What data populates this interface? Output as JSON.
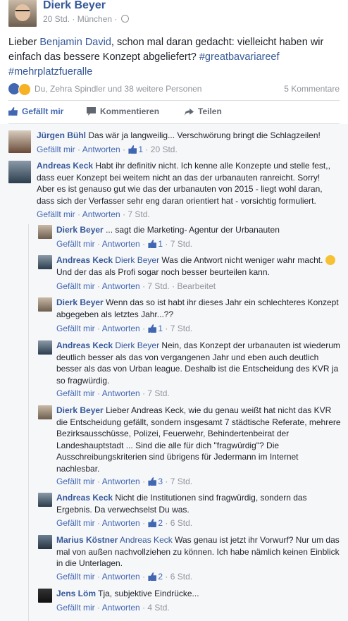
{
  "post": {
    "author": "Dierk Beyer",
    "time": "20 Std.",
    "location": "München",
    "text_before": "Lieber ",
    "mention": "Benjamin David",
    "text_after": ", schon mal daran gedacht: vielleicht haben wir einfach das bessere Konzept abgeliefert? ",
    "hashtag1": "#greatbavariareef",
    "hashtag2": "#mehrplatzfueralle"
  },
  "reactions": {
    "names": "Du, Zehra Spindler und 38 weitere Personen",
    "comment_count": "5 Kommentare"
  },
  "actions": {
    "like": "Gefällt mir",
    "comment": "Kommentieren",
    "share": "Teilen"
  },
  "labels": {
    "like": "Gefällt mir",
    "reply": "Antworten",
    "edited": "Bearbeitet"
  },
  "comments": [
    {
      "name": "Jürgen Bühl",
      "mention": "",
      "text": "Das wär ja langweilig... Verschwörung bringt die Schlagzeilen!",
      "likes": "1",
      "time": "20 Std."
    },
    {
      "name": "Andreas Keck",
      "mention": "",
      "text": "Habt ihr definitiv nicht. Ich kenne alle Konzepte und stelle fest,, dass euer Konzept bei weitem nicht an das der urbanauten ranreicht. Sorry! Aber es ist genauso gut wie das der urbanauten von 2015 - liegt wohl daran, dass sich der Verfasser sehr eng daran orientiert hat - vorsichtig formuliert.",
      "likes": "",
      "time": "7 Std."
    }
  ],
  "replies": [
    {
      "name": "Dierk Beyer",
      "mention": "",
      "text": "... sagt die Marketing- Agentur der Urbanauten",
      "likes": "1",
      "time": "7 Std."
    },
    {
      "name": "Andreas Keck",
      "mention": "Dierk Beyer",
      "text": "Was die Antwort nicht weniger wahr macht.",
      "text2": "Und der das als Profi sogar noch besser beurteilen kann.",
      "likes": "",
      "time": "7 Std."
    },
    {
      "name": "Dierk Beyer",
      "mention": "",
      "text": "Wenn das so ist habt ihr dieses Jahr ein schlechteres Konzept abgegeben als letztes Jahr...??",
      "likes": "1",
      "time": "7 Std."
    },
    {
      "name": "Andreas Keck",
      "mention": "Dierk Beyer",
      "text": "Nein, das Konzept der urbanauten ist wiederum deutlich besser als das von vergangenen Jahr und eben auch deutlich besser als das von Urban league. Deshalb ist die Entscheidung des KVR ja so fragwürdig.",
      "likes": "",
      "time": "7 Std."
    },
    {
      "name": "Dierk Beyer",
      "mention": "",
      "text": "Lieber Andreas Keck, wie du genau weißt hat nicht das KVR die Entscheidung gefällt, sondern insgesamt 7 städtische Referate, mehrere Bezirksausschüsse, Polizei, Feuerwehr, Behindertenbeirat der Landeshauptstadt ... Sind die alle für dich \"fragwürdig\"? Die Ausschreibungskriterien sind übrigens für Jedermann im Internet nachlesbar.",
      "likes": "3",
      "time": "7 Std."
    },
    {
      "name": "Andreas Keck",
      "mention": "",
      "text": "Nicht die Institutionen sind fragwürdig, sondern das Ergebnis. Da verwechselst Du was.",
      "likes": "2",
      "time": "6 Std."
    },
    {
      "name": "Marius Köstner",
      "mention": "Andreas Keck",
      "text": "Was genau ist jetzt ihr Vorwurf? Nur um das mal von außen nachvollziehen zu können. Ich habe nämlich keinen Einblick in die Unterlagen.",
      "likes": "2",
      "time": "6 Std."
    },
    {
      "name": "Jens Löm",
      "mention": "",
      "text": "Tja, subjektive Eindrücke...",
      "likes": "",
      "time": "4 Std."
    }
  ]
}
